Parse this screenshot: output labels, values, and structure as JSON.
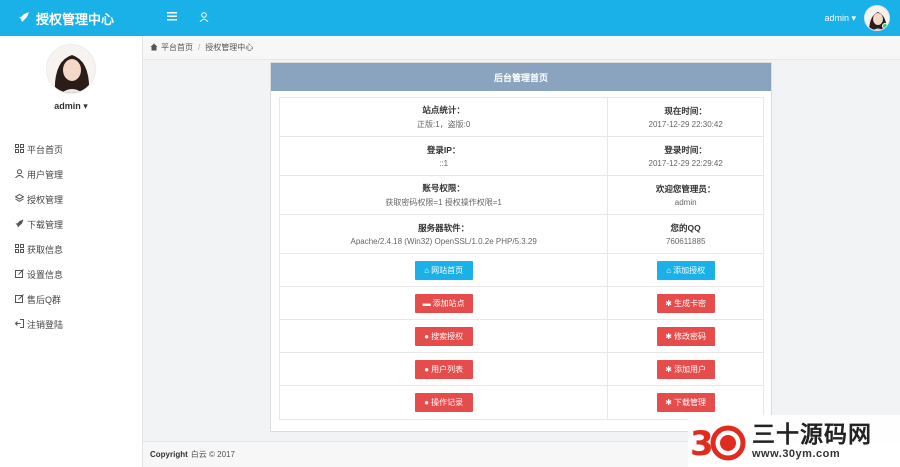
{
  "header": {
    "brand": "授权管理中心",
    "menu_icon": "bars-icon",
    "user_icon": "user-icon",
    "username": "admin",
    "caret": "▾",
    "accent": "#1ab0e8"
  },
  "sidebar": {
    "username": "admin",
    "items": [
      {
        "icon": "grid-icon",
        "label": "平台首页"
      },
      {
        "icon": "user-icon",
        "label": "用户管理"
      },
      {
        "icon": "layers-icon",
        "label": "授权管理"
      },
      {
        "icon": "rocket-icon",
        "label": "下载管理"
      },
      {
        "icon": "grid-icon",
        "label": "获取信息"
      },
      {
        "icon": "edit-icon",
        "label": "设置信息"
      },
      {
        "icon": "edit-icon",
        "label": "售后Q群"
      },
      {
        "icon": "logout-icon",
        "label": "注销登陆"
      }
    ]
  },
  "breadcrumb": {
    "home": "平台首页",
    "current": "授权管理中心"
  },
  "panel": {
    "title": "后台管理首页",
    "header_color": "#8aa3bf",
    "rows": [
      {
        "lk": "站点统计：",
        "lv": "正版:1，盗版:0",
        "rk": "现在时间：",
        "rv": "2017-12-29 22:30:42"
      },
      {
        "lk": "登录IP：",
        "lv": "::1",
        "rk": "登录时间：",
        "rv": "2017-12-29 22:29:42"
      },
      {
        "lk": "账号权限：",
        "lv": "获取密码权限=1 授权操作权限=1",
        "rk": "欢迎您管理员：",
        "rv": "admin"
      },
      {
        "lk": "服务器软件：",
        "lv": "Apache/2.4.18 (Win32) OpenSSL/1.0.2e PHP/5.3.29",
        "rk": "您的QQ",
        "rv": "760611885"
      }
    ],
    "buttons": [
      {
        "left": {
          "label": "网站首页",
          "color": "blue",
          "icon": "home-icon"
        },
        "right": {
          "label": "添加授权",
          "color": "blue",
          "icon": "home-icon"
        }
      },
      {
        "left": {
          "label": "添加站点",
          "color": "red",
          "icon": "folder-icon"
        },
        "right": {
          "label": "生成卡密",
          "color": "red",
          "icon": "gear-icon"
        }
      },
      {
        "left": {
          "label": "搜索授权",
          "color": "red",
          "icon": "globe-icon"
        },
        "right": {
          "label": "修改密码",
          "color": "red",
          "icon": "gear-icon"
        }
      },
      {
        "left": {
          "label": "用户列表",
          "color": "red",
          "icon": "globe-icon"
        },
        "right": {
          "label": "添加用户",
          "color": "red",
          "icon": "gear-icon"
        }
      },
      {
        "left": {
          "label": "操作记录",
          "color": "red",
          "icon": "globe-icon"
        },
        "right": {
          "label": "下载管理",
          "color": "red",
          "icon": "gear-icon"
        }
      }
    ]
  },
  "footer": {
    "label": "Copyright",
    "text": "白云 © 2017"
  },
  "watermark": {
    "title": "三十源码网",
    "url": "www.30ym.com"
  }
}
